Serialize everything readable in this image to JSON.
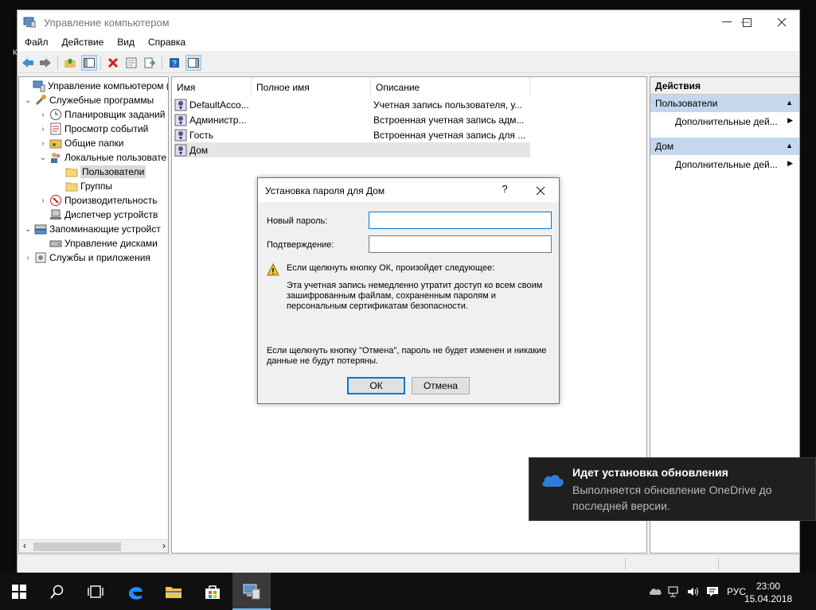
{
  "window": {
    "title": "Управление компьютером",
    "controls": {
      "minimize": "—",
      "maximize": "☐",
      "close": "✕"
    }
  },
  "desktop": {
    "edge_letter": "к"
  },
  "menu": [
    "Файл",
    "Действие",
    "Вид",
    "Справка"
  ],
  "toolbar": {
    "icons": [
      "back-arrow-icon",
      "forward-arrow-icon",
      "up-folder-icon",
      "show-hide-tree-icon",
      "delete-icon",
      "properties-icon",
      "export-list-icon",
      "help-icon",
      "show-hide-action-pane-icon"
    ]
  },
  "tree": {
    "items": [
      {
        "label": "Управление компьютером (л",
        "level": 0,
        "expander": "",
        "icon": "computer-management-icon"
      },
      {
        "label": "Служебные программы",
        "level": 1,
        "expander": "⌄",
        "icon": "tools-icon"
      },
      {
        "label": "Планировщик заданий",
        "level": 2,
        "expander": "›",
        "icon": "clock-icon"
      },
      {
        "label": "Просмотр событий",
        "level": 2,
        "expander": "›",
        "icon": "event-viewer-icon"
      },
      {
        "label": "Общие папки",
        "level": 2,
        "expander": "›",
        "icon": "shared-folder-icon"
      },
      {
        "label": "Локальные пользовате",
        "level": 2,
        "expander": "⌄",
        "icon": "users-icon"
      },
      {
        "label": "Пользователи",
        "level": 3,
        "expander": "",
        "icon": "folder-icon",
        "selected": true
      },
      {
        "label": "Группы",
        "level": 3,
        "expander": "",
        "icon": "folder-icon"
      },
      {
        "label": "Производительность",
        "level": 2,
        "expander": "›",
        "icon": "performance-icon"
      },
      {
        "label": "Диспетчер устройств",
        "level": 2,
        "expander": "",
        "icon": "device-manager-icon"
      },
      {
        "label": "Запоминающие устройст",
        "level": 1,
        "expander": "⌄",
        "icon": "storage-icon"
      },
      {
        "label": "Управление дисками",
        "level": 2,
        "expander": "",
        "icon": "disk-icon"
      },
      {
        "label": "Службы и приложения",
        "level": 1,
        "expander": "›",
        "icon": "services-icon"
      }
    ],
    "scroll_left": "‹",
    "scroll_right": "›"
  },
  "list": {
    "columns": [
      "Имя",
      "Полное имя",
      "Описание"
    ],
    "rows": [
      {
        "name": "DefaultAcco...",
        "fullname": "",
        "description": "Учетная запись пользователя, у..."
      },
      {
        "name": "Администр...",
        "fullname": "",
        "description": "Встроенная учетная запись адм..."
      },
      {
        "name": "Гость",
        "fullname": "",
        "description": "Встроенная учетная запись для ..."
      },
      {
        "name": "Дом",
        "fullname": "",
        "description": "",
        "selected": true
      }
    ]
  },
  "actions": {
    "title": "Действия",
    "sections": [
      {
        "header": "Пользователи",
        "item": "Дополнительные дей..."
      },
      {
        "header": "Дом",
        "item": "Дополнительные дей..."
      }
    ],
    "collapse_glyph": "▲",
    "expand_glyph": "▶"
  },
  "dialog": {
    "title": "Установка пароля для Дом",
    "help": "?",
    "new_password_label": "Новый пароль:",
    "confirm_label": "Подтверждение:",
    "new_password_value": "",
    "confirm_value": "",
    "warning_heading": "Если щелкнуть кнопку ОК, произойдет следующее:",
    "warning_line1": "Эта учетная запись немедленно утратит доступ ко всем своим",
    "warning_line2": "зашифрованным файлам, сохраненным паролям и",
    "warning_line3": "персональным сертификатам безопасности.",
    "cancel_note_line1": "Если щелкнуть кнопку \"Отмена\", пароль не будет изменен и никакие",
    "cancel_note_line2": "данные не будут потеряны.",
    "ok_label": "ОК",
    "cancel_label": "Отмена"
  },
  "toast": {
    "title": "Идет установка обновления",
    "body": "Выполняется обновление OneDrive до последней версии."
  },
  "taskbar": {
    "language": "РУС",
    "time": "23:00",
    "date": "15.04.2018"
  },
  "colors": {
    "accent": "#0078d7",
    "taskbar": "#101010",
    "action_section": "#c4d7ec"
  }
}
